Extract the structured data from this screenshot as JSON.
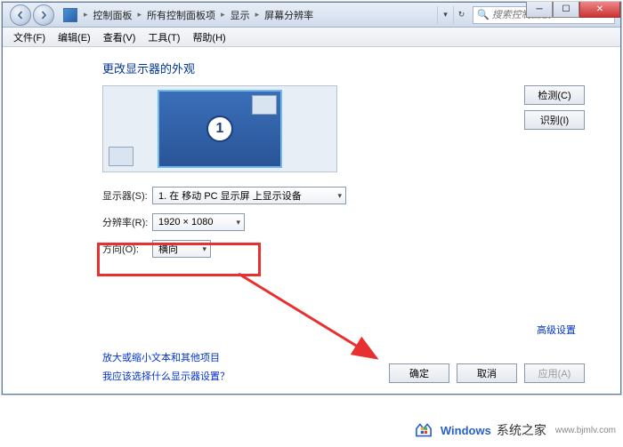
{
  "breadcrumb": {
    "items": [
      "控制面板",
      "所有控制面板项",
      "显示",
      "屏幕分辨率"
    ]
  },
  "search": {
    "placeholder": "搜索控制面板"
  },
  "menubar": [
    "文件(F)",
    "编辑(E)",
    "查看(V)",
    "工具(T)",
    "帮助(H)"
  ],
  "heading": "更改显示器的外观",
  "monitor": {
    "number": "1"
  },
  "side_buttons": {
    "detect": "检测(C)",
    "identify": "识别(I)"
  },
  "form": {
    "display_label": "显示器(S):",
    "display_value": "1. 在 移动 PC 显示屏 上显示设备",
    "resolution_label": "分辨率(R):",
    "resolution_value": "1920 × 1080",
    "orientation_label": "方向(O):",
    "orientation_value": "横向"
  },
  "advanced_link": "高级设置",
  "help_links": {
    "scale": "放大或缩小文本和其他项目",
    "which": "我应该选择什么显示器设置？"
  },
  "footer": {
    "ok": "确定",
    "cancel": "取消",
    "apply": "应用(A)"
  },
  "watermark": {
    "brand": "Windows",
    "suffix": "系统之家",
    "url": "www.bjmlv.com"
  }
}
